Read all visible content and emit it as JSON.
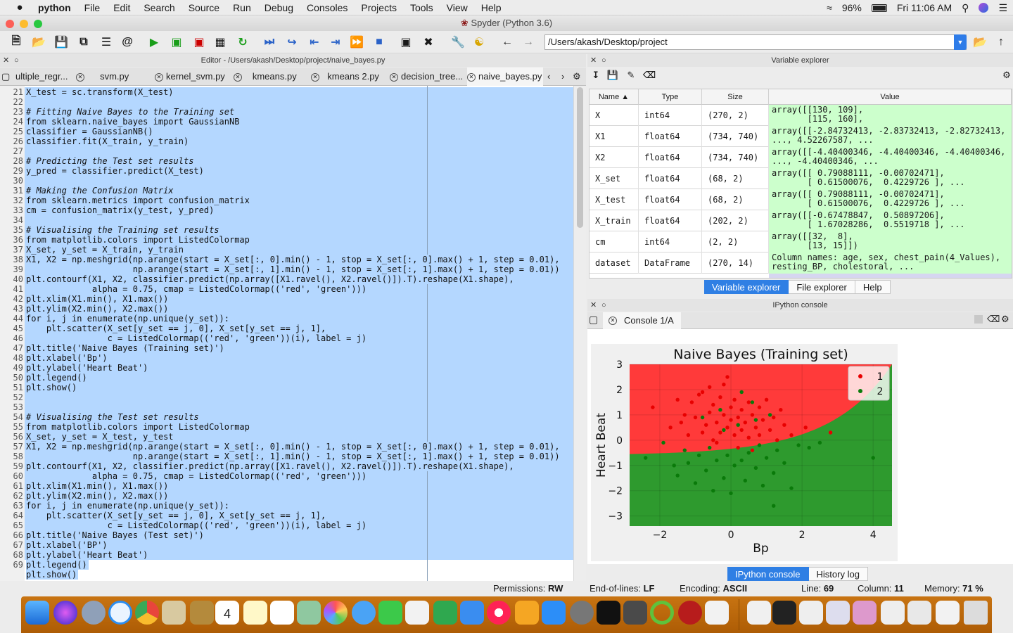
{
  "menubar": {
    "app_name": "python",
    "items": [
      "File",
      "Edit",
      "Search",
      "Source",
      "Run",
      "Debug",
      "Consoles",
      "Projects",
      "Tools",
      "View",
      "Help"
    ],
    "battery": "96%",
    "clock": "Fri 11:06 AM"
  },
  "window": {
    "title": "Spyder (Python 3.6)"
  },
  "toolbar": {
    "path": "/Users/akash/Desktop/project"
  },
  "editor": {
    "header": "Editor - /Users/akash/Desktop/project/naive_bayes.py",
    "tabs": [
      "ultiple_regr...",
      "svm.py",
      "kernel_svm.py",
      "kmeans.py",
      "kmeans 2.py",
      "decision_tree...",
      "naive_bayes.py"
    ],
    "line_numbers": [
      "21",
      "22",
      "23",
      "24",
      "25",
      "26",
      "27",
      "28",
      "29",
      "30",
      "31",
      "32",
      "33",
      "34",
      "35",
      "36",
      "37",
      "38",
      "39",
      "40",
      "41",
      "42",
      "43",
      "44",
      "45",
      "46",
      "47",
      "48",
      "49",
      "50",
      "51",
      "52",
      "53",
      "54",
      "55",
      "56",
      "57",
      "58",
      "59",
      "60",
      "61",
      "62",
      "63",
      "64",
      "65",
      "66",
      "67",
      "68",
      "69"
    ],
    "lines": [
      "X_test = sc.transform(X_test)",
      "",
      "# Fitting Naive Bayes to the Training set",
      "from sklearn.naive_bayes import GaussianNB",
      "classifier = GaussianNB()",
      "classifier.fit(X_train, y_train)",
      "",
      "# Predicting the Test set results",
      "y_pred = classifier.predict(X_test)",
      "",
      "# Making the Confusion Matrix",
      "from sklearn.metrics import confusion_matrix",
      "cm = confusion_matrix(y_test, y_pred)",
      "",
      "# Visualising the Training set results",
      "from matplotlib.colors import ListedColormap",
      "X_set, y_set = X_train, y_train",
      "X1, X2 = np.meshgrid(np.arange(start = X_set[:, 0].min() - 1, stop = X_set[:, 0].max() + 1, step = 0.01),",
      "                     np.arange(start = X_set[:, 1].min() - 1, stop = X_set[:, 1].max() + 1, step = 0.01))",
      "plt.contourf(X1, X2, classifier.predict(np.array([X1.ravel(), X2.ravel()]).T).reshape(X1.shape),",
      "             alpha = 0.75, cmap = ListedColormap(('red', 'green')))",
      "plt.xlim(X1.min(), X1.max())",
      "plt.ylim(X2.min(), X2.max())",
      "for i, j in enumerate(np.unique(y_set)):",
      "    plt.scatter(X_set[y_set == j, 0], X_set[y_set == j, 1],",
      "                c = ListedColormap(('red', 'green'))(i), label = j)",
      "plt.title('Naive Bayes (Training set)')",
      "plt.xlabel('Bp')",
      "plt.ylabel('Heart Beat')",
      "plt.legend()",
      "plt.show()",
      "",
      "",
      "# Visualising the Test set results",
      "from matplotlib.colors import ListedColormap",
      "X_set, y_set = X_test, y_test",
      "X1, X2 = np.meshgrid(np.arange(start = X_set[:, 0].min() - 1, stop = X_set[:, 0].max() + 1, step = 0.01),",
      "                     np.arange(start = X_set[:, 1].min() - 1, stop = X_set[:, 1].max() + 1, step = 0.01))",
      "plt.contourf(X1, X2, classifier.predict(np.array([X1.ravel(), X2.ravel()]).T).reshape(X1.shape),",
      "             alpha = 0.75, cmap = ListedColormap(('red', 'green')))",
      "plt.xlim(X1.min(), X1.max())",
      "plt.ylim(X2.min(), X2.max())",
      "for i, j in enumerate(np.unique(y_set)):",
      "    plt.scatter(X_set[y_set == j, 0], X_set[y_set == j, 1],",
      "                c = ListedColormap(('red', 'green'))(i), label = j)",
      "plt.title('Naive Bayes (Test set)')",
      "plt.xlabel('BP')",
      "plt.ylabel('Heart Beat')",
      "plt.legend()",
      "plt.show()"
    ]
  },
  "variable_explorer": {
    "header": "Variable explorer",
    "columns": [
      "Name",
      "Type",
      "Size",
      "Value"
    ],
    "rows": [
      {
        "name": "X",
        "type": "int64",
        "size": "(270, 2)",
        "value": "array([[130, 109],\n       [115, 160],"
      },
      {
        "name": "X1",
        "type": "float64",
        "size": "(734, 740)",
        "value": "array([[-2.84732413, -2.83732413, -2.82732413,\n..., 4.52267587, ..."
      },
      {
        "name": "X2",
        "type": "float64",
        "size": "(734, 740)",
        "value": "array([[-4.40400346, -4.40400346, -4.40400346,\n..., -4.40400346, ..."
      },
      {
        "name": "X_set",
        "type": "float64",
        "size": "(68, 2)",
        "value": "array([[ 0.79088111, -0.00702471],\n       [ 0.61500076,  0.4229726 ], ..."
      },
      {
        "name": "X_test",
        "type": "float64",
        "size": "(68, 2)",
        "value": "array([[ 0.79088111, -0.00702471],\n       [ 0.61500076,  0.4229726 ], ..."
      },
      {
        "name": "X_train",
        "type": "float64",
        "size": "(202, 2)",
        "value": "array([[-0.67478847,  0.50897206],\n       [ 1.67028286,  0.5519718 ], ..."
      },
      {
        "name": "cm",
        "type": "int64",
        "size": "(2, 2)",
        "value": "array([[32,  8],\n       [13, 15]])"
      },
      {
        "name": "dataset",
        "type": "DataFrame",
        "size": "(270, 14)",
        "value": "Column names: age, sex, chest_pain(4_Values),\nresting_BP, cholestoral, ..."
      }
    ],
    "tabs": [
      "Variable explorer",
      "File explorer",
      "Help"
    ]
  },
  "console": {
    "header": "IPython console",
    "tab": "Console 1/A",
    "tabs": [
      "IPython console",
      "History log"
    ]
  },
  "chart_data": {
    "type": "scatter",
    "title": "Naive Bayes (Training set)",
    "xlabel": "Bp",
    "ylabel": "Heart Beat",
    "xlim": [
      -2.85,
      4.53
    ],
    "ylim": [
      -3.4,
      3.0
    ],
    "xticks": [
      "−2",
      "0",
      "2",
      "4"
    ],
    "yticks": [
      "3",
      "2",
      "1",
      "0",
      "−1",
      "−2",
      "−3"
    ],
    "xtick_values": [
      -2,
      0,
      2,
      4
    ],
    "ytick_values": [
      3,
      2,
      1,
      0,
      -1,
      -2,
      -3
    ],
    "region_colors": {
      "class_1": "#ff3a3a",
      "class_2": "#2e9a2e"
    },
    "legend": {
      "placement": "top-right",
      "entries": [
        "1",
        "2"
      ]
    },
    "series": [
      {
        "name": "1",
        "color": "#e80000",
        "points": [
          [
            -2.2,
            1.3
          ],
          [
            -1.7,
            0.5
          ],
          [
            -1.4,
            0.7
          ],
          [
            -1.3,
            1.0
          ],
          [
            -1.2,
            0.2
          ],
          [
            -1.1,
            1.5
          ],
          [
            -1.0,
            0.9
          ],
          [
            -0.9,
            1.8
          ],
          [
            -0.8,
            0.3
          ],
          [
            -0.7,
            0.6
          ],
          [
            -0.6,
            1.1
          ],
          [
            -0.6,
            2.1
          ],
          [
            -0.5,
            0.0
          ],
          [
            -0.5,
            1.4
          ],
          [
            -0.4,
            0.7
          ],
          [
            -0.3,
            1.7
          ],
          [
            -0.3,
            0.3
          ],
          [
            -0.2,
            1.0
          ],
          [
            -0.2,
            2.2
          ],
          [
            -0.1,
            0.5
          ],
          [
            0.0,
            1.3
          ],
          [
            0.0,
            0.8
          ],
          [
            0.1,
            0.2
          ],
          [
            0.1,
            1.6
          ],
          [
            0.2,
            0.9
          ],
          [
            0.3,
            0.4
          ],
          [
            0.3,
            1.2
          ],
          [
            0.4,
            0.7
          ],
          [
            0.5,
            1.5
          ],
          [
            0.5,
            0.1
          ],
          [
            0.6,
            1.0
          ],
          [
            0.7,
            0.5
          ],
          [
            0.8,
            1.3
          ],
          [
            0.8,
            0.2
          ],
          [
            0.9,
            0.8
          ],
          [
            1.0,
            1.6
          ],
          [
            1.1,
            0.4
          ],
          [
            1.2,
            0.9
          ],
          [
            1.3,
            0.0
          ],
          [
            1.5,
            0.6
          ],
          [
            1.7,
            0.2
          ],
          [
            2.1,
            0.5
          ],
          [
            2.8,
            0.3
          ],
          [
            0.2,
            -0.3
          ],
          [
            -0.4,
            -0.1
          ],
          [
            0.6,
            -0.4
          ],
          [
            -0.8,
            1.9
          ],
          [
            1.4,
            1.2
          ],
          [
            -1.5,
            1.6
          ],
          [
            -0.1,
            2.5
          ]
        ]
      },
      {
        "name": "2",
        "color": "#0a7a0a",
        "points": [
          [
            -2.4,
            -0.7
          ],
          [
            -1.9,
            -0.1
          ],
          [
            -1.6,
            -1.0
          ],
          [
            -1.5,
            -1.4
          ],
          [
            -1.3,
            -0.4
          ],
          [
            -1.2,
            -0.9
          ],
          [
            -1.0,
            -1.7
          ],
          [
            -0.9,
            -0.6
          ],
          [
            -0.8,
            0.9
          ],
          [
            -0.7,
            -1.2
          ],
          [
            -0.6,
            -0.3
          ],
          [
            -0.5,
            -2.0
          ],
          [
            -0.4,
            -0.8
          ],
          [
            -0.3,
            1.2
          ],
          [
            -0.2,
            -1.5
          ],
          [
            -0.1,
            -0.6
          ],
          [
            0.0,
            -2.1
          ],
          [
            0.1,
            -1.0
          ],
          [
            0.2,
            0.6
          ],
          [
            0.3,
            -0.8
          ],
          [
            0.4,
            -1.6
          ],
          [
            0.5,
            -0.5
          ],
          [
            0.6,
            1.5
          ],
          [
            0.7,
            -1.1
          ],
          [
            0.8,
            -0.2
          ],
          [
            0.9,
            -1.8
          ],
          [
            1.0,
            -0.7
          ],
          [
            1.1,
            1.0
          ],
          [
            1.2,
            -1.3
          ],
          [
            1.3,
            -0.4
          ],
          [
            1.5,
            -0.9
          ],
          [
            1.7,
            -1.9
          ],
          [
            1.9,
            -0.2
          ],
          [
            2.2,
            -0.3
          ],
          [
            2.5,
            -0.1
          ],
          [
            4.0,
            -0.7
          ],
          [
            1.2,
            -2.6
          ],
          [
            0.3,
            1.9
          ],
          [
            -0.2,
            0.4
          ],
          [
            0.7,
            0.8
          ]
        ]
      }
    ]
  }
}
